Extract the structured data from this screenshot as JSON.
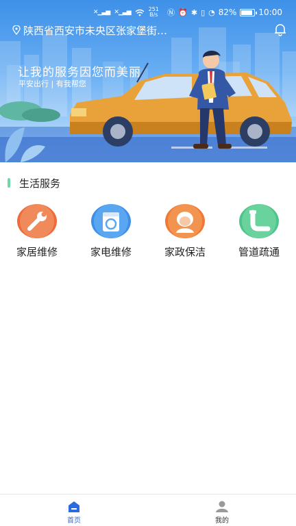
{
  "status_bar": {
    "net_speed_value": "251",
    "net_speed_unit": "B/s",
    "battery": "82%",
    "time": "10:00"
  },
  "header": {
    "location": "陕西省西安市未央区张家堡街…",
    "icons": [
      "location-pin-icon",
      "bell-icon"
    ]
  },
  "banner": {
    "slogan": "让我的服务因您而美丽",
    "sub_slogan": "平安出行 | 有我帮您"
  },
  "section": {
    "title": "生活服务",
    "accent_color": "#6fd7a6"
  },
  "services": [
    {
      "label": "家居维修",
      "icon": "wrench-icon",
      "color": "#f06a3a"
    },
    {
      "label": "家电维修",
      "icon": "washing-machine-icon",
      "color": "#3d8fe8"
    },
    {
      "label": "家政保洁",
      "icon": "cleaner-icon",
      "color": "#f07a35"
    },
    {
      "label": "管道疏通",
      "icon": "pipe-icon",
      "color": "#4fc48a"
    }
  ],
  "bottom_nav": [
    {
      "label": "首页",
      "icon": "home-icon",
      "active": true,
      "color": "#2b6be0"
    },
    {
      "label": "我的",
      "icon": "user-icon",
      "active": false,
      "color": "#333333"
    }
  ]
}
